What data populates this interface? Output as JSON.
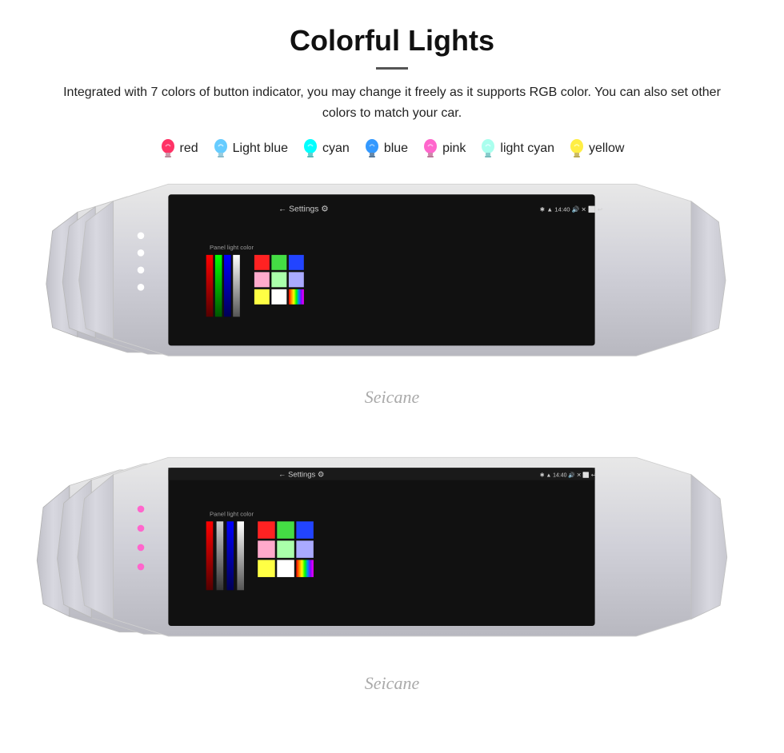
{
  "header": {
    "title": "Colorful Lights",
    "description": "Integrated with 7 colors of button indicator, you may change it freely as it supports RGB color. You can also set other colors to match your car."
  },
  "colors": [
    {
      "name": "red",
      "color": "#ff3366",
      "hex": "#ff3366"
    },
    {
      "name": "Light blue",
      "color": "#66ccff",
      "hex": "#66ccff"
    },
    {
      "name": "cyan",
      "color": "#00ffff",
      "hex": "#00ffff"
    },
    {
      "name": "blue",
      "color": "#3399ff",
      "hex": "#3399ff"
    },
    {
      "name": "pink",
      "color": "#ff66cc",
      "hex": "#ff66cc"
    },
    {
      "name": "light cyan",
      "color": "#aaffee",
      "hex": "#aaffee"
    },
    {
      "name": "yellow",
      "color": "#ffee44",
      "hex": "#ffee44"
    }
  ],
  "screen": {
    "settings_label": "Settings",
    "time": "14:40",
    "panel_light_label": "Panel light color"
  },
  "watermark": "Seicane",
  "sections": [
    {
      "id": "top",
      "button_colors": [
        "#ffffff",
        "#ffffff",
        "#ffffff"
      ]
    },
    {
      "id": "bottom",
      "button_colors": [
        "#ff0000",
        "#00ffff",
        "#ff66cc"
      ]
    }
  ]
}
